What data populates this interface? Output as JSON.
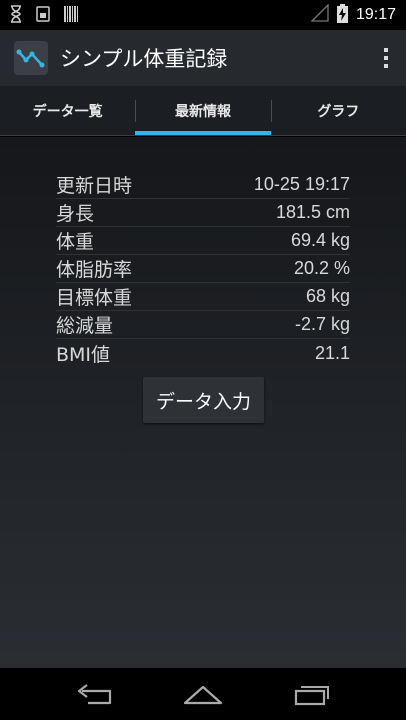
{
  "status_bar": {
    "time": "19:17",
    "icons": [
      "hourglass-icon",
      "sim-icon",
      "barcode-icon",
      "signal-icon",
      "battery-charging-icon"
    ]
  },
  "action_bar": {
    "title": "シンプル体重記録",
    "app_icon": "chart-line-icon",
    "overflow_icon": "more-vert-icon"
  },
  "tabs": [
    {
      "label": "データ一覧",
      "active": false
    },
    {
      "label": "最新情報",
      "active": true
    },
    {
      "label": "グラフ",
      "active": false
    }
  ],
  "info": [
    {
      "label": "更新日時",
      "value": "10-25 19:17"
    },
    {
      "label": "身長",
      "value": "181.5 cm"
    },
    {
      "label": "体重",
      "value": "69.4 kg"
    },
    {
      "label": "体脂肪率",
      "value": "20.2 %"
    },
    {
      "label": "目標体重",
      "value": "68 kg"
    },
    {
      "label": "総減量",
      "value": "-2.7 kg"
    },
    {
      "label": "BMI値",
      "value": "21.1"
    }
  ],
  "button": {
    "label": "データ入力"
  },
  "nav": [
    "back-icon",
    "home-icon",
    "recent-apps-icon"
  ],
  "colors": {
    "accent": "#33b5e5",
    "action_bar": "#262a2f"
  }
}
